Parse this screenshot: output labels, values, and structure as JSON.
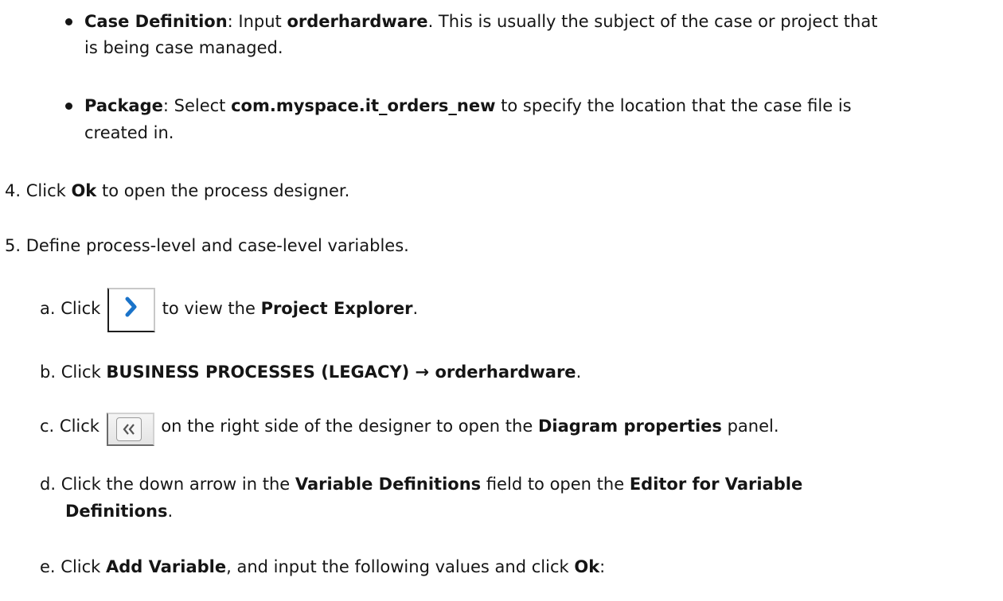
{
  "item1": {
    "label": "Case Definition",
    "text_a": ": Input ",
    "value": "orderhardware",
    "text_b": ". This is usually the subject of the case or project that",
    "continuation": "is being case managed."
  },
  "item2": {
    "label": "Package",
    "text_a": ": Select ",
    "value": "com.myspace.it_orders_new",
    "text_b": " to specify the location that the case file is",
    "continuation": "created in."
  },
  "step4": {
    "number": "4.",
    "text_a": "Click ",
    "ok": "Ok",
    "text_b": " to open the process designer."
  },
  "step5": {
    "number": "5.",
    "text": "Define process-level and case-level variables."
  },
  "substeps": {
    "a": {
      "letter": "a.",
      "text_a": "Click ",
      "icon": "chevron-right-icon",
      "text_b": " to view the ",
      "target": "Project Explorer",
      "text_c": "."
    },
    "b": {
      "letter": "b.",
      "text_a": "Click ",
      "target": "BUSINESS PROCESSES (LEGACY) → orderhardware",
      "text_b": "."
    },
    "c": {
      "letter": "c.",
      "text_a": "Click ",
      "icon": "double-chevron-left-icon",
      "text_b": " on the right side of the designer to open the ",
      "target": "Diagram properties",
      "text_c": " panel."
    },
    "d": {
      "letter": "d.",
      "text_a": "Click the down arrow in the ",
      "field": "Variable Definitions",
      "text_b": " field to open the ",
      "target": "Editor for Variable",
      "continuation": "Definitions",
      "text_c": "."
    },
    "e": {
      "letter": "e.",
      "text_a": "Click ",
      "add": "Add Variable",
      "text_b": ", and input the following values and click ",
      "ok": "Ok",
      "text_c": ":"
    }
  },
  "colors": {
    "text": "#151515",
    "chevron_blue": "#1a73c9"
  }
}
